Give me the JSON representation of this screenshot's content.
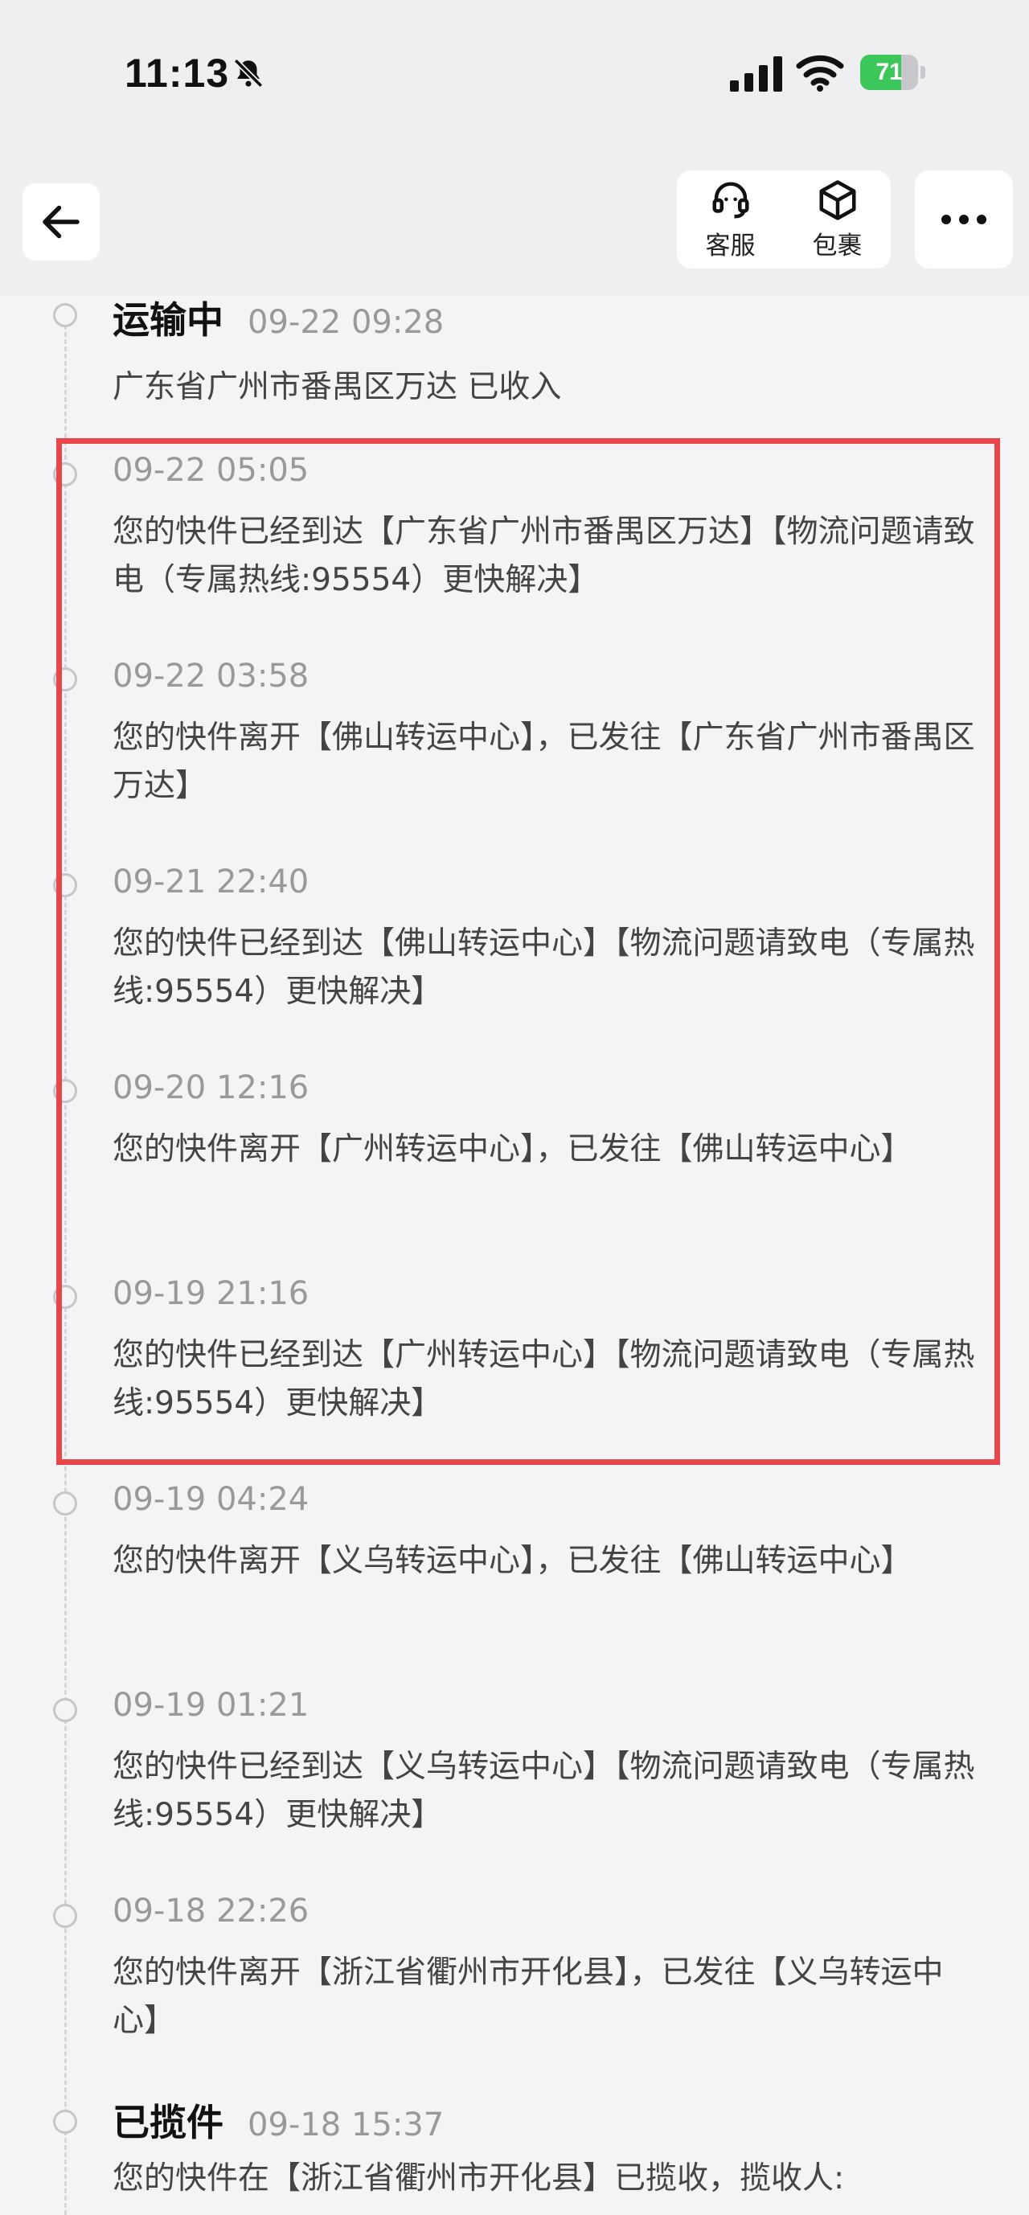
{
  "status_bar": {
    "time": "11:13",
    "battery": "71",
    "battery_level": 0.71,
    "icons": [
      "bell-slash-icon",
      "cellular-signal-icon",
      "wifi-icon",
      "battery-charging-icon"
    ]
  },
  "header": {
    "back_icon": "arrow-left-icon",
    "customer_service": {
      "label": "客服",
      "icon": "headset-icon"
    },
    "package": {
      "label": "包裹",
      "icon": "package-box-icon"
    },
    "more_icon": "more-horizontal-icon"
  },
  "timeline": [
    {
      "status": "运输中",
      "time": "09-22 09:28",
      "text": "广东省广州市番禺区万达 已收入"
    },
    {
      "status": "",
      "time": "09-22 05:05",
      "text": "您的快件已经到达【广东省广州市番禺区万达】【物流问题请致电（专属热线:95554）更快解决】"
    },
    {
      "status": "",
      "time": "09-22 03:58",
      "text": "您的快件离开【佛山转运中心】，已发往【广东省广州市番禺区万达】"
    },
    {
      "status": "",
      "time": "09-21 22:40",
      "text": "您的快件已经到达【佛山转运中心】【物流问题请致电（专属热线:95554）更快解决】"
    },
    {
      "status": "",
      "time": "09-20 12:16",
      "text": "您的快件离开【广州转运中心】，已发往【佛山转运中心】"
    },
    {
      "status": "",
      "time": "09-19 21:16",
      "text": "您的快件已经到达【广州转运中心】【物流问题请致电（专属热线:95554）更快解决】"
    },
    {
      "status": "",
      "time": "09-19 04:24",
      "text": "您的快件离开【义乌转运中心】，已发往【佛山转运中心】"
    },
    {
      "status": "",
      "time": "09-19 01:21",
      "text": "您的快件已经到达【义乌转运中心】【物流问题请致电（专属热线:95554）更快解决】"
    },
    {
      "status": "",
      "time": "09-18 22:26",
      "text": "您的快件离开【浙江省衢州市开化县】，已发往【义乌转运中心】"
    },
    {
      "status": "已揽件",
      "time": "09-18 15:37",
      "text": "您的快件在【浙江省衢州市开化县】已揽收，揽收人:"
    }
  ],
  "colors": {
    "highlight": "#e8464a",
    "background": "#f4f4f6"
  }
}
